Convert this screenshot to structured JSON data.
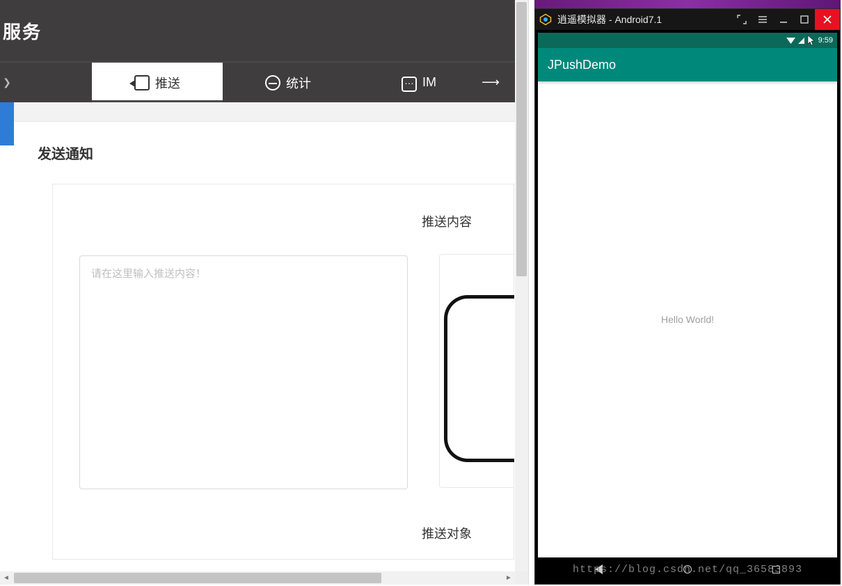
{
  "dashboard": {
    "header_text": "服务",
    "tabs": {
      "push": {
        "label": "推送"
      },
      "stats": {
        "label": "统计"
      },
      "im": {
        "label": "IM"
      }
    },
    "section_title": "发送通知",
    "panel": {
      "content_label": "推送内容",
      "target_label": "推送对象",
      "textarea_placeholder": "请在这里输入推送内容！",
      "textarea_value": ""
    }
  },
  "emulator": {
    "window_title": "逍遥模拟器 - Android7.1",
    "status_time": "9:59",
    "app_title": "JPushDemo",
    "body_text": "Hello World!",
    "watermark": "https://blog.csdn.net/qq_36583893"
  }
}
